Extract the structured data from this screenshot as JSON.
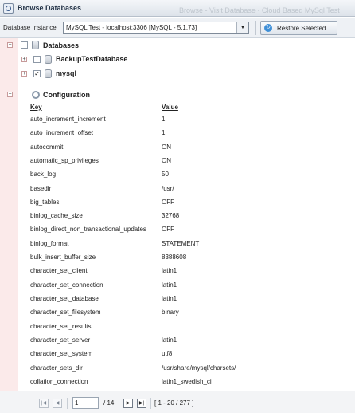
{
  "window": {
    "title": "Browse Databases",
    "ghost_text": "Browse  - Visit  Database  ·  Cloud Based MySql Test"
  },
  "toolbar": {
    "instance_label": "Database Instance",
    "instance_value": "MySQL Test - localhost:3306 [MySQL - 5.1.73]",
    "restore_label": "Restore Selected"
  },
  "tree": {
    "root_label": "Databases",
    "databases": [
      {
        "label": "BackupTestDatabase",
        "checked": false
      },
      {
        "label": "mysql",
        "checked": true
      }
    ],
    "config_label": "Configuration"
  },
  "config_table": {
    "headers": {
      "key": "Key",
      "value": "Value"
    },
    "rows": [
      {
        "key": "auto_increment_increment",
        "value": "1"
      },
      {
        "key": "auto_increment_offset",
        "value": "1"
      },
      {
        "key": "autocommit",
        "value": "ON"
      },
      {
        "key": "automatic_sp_privileges",
        "value": "ON"
      },
      {
        "key": "back_log",
        "value": "50"
      },
      {
        "key": "basedir",
        "value": "/usr/"
      },
      {
        "key": "big_tables",
        "value": "OFF"
      },
      {
        "key": "binlog_cache_size",
        "value": "32768"
      },
      {
        "key": "binlog_direct_non_transactional_updates",
        "value": "OFF"
      },
      {
        "key": "binlog_format",
        "value": "STATEMENT"
      },
      {
        "key": "bulk_insert_buffer_size",
        "value": "8388608"
      },
      {
        "key": "character_set_client",
        "value": "latin1"
      },
      {
        "key": "character_set_connection",
        "value": "latin1"
      },
      {
        "key": "character_set_database",
        "value": "latin1"
      },
      {
        "key": "character_set_filesystem",
        "value": "binary"
      },
      {
        "key": "character_set_results",
        "value": ""
      },
      {
        "key": "character_set_server",
        "value": "latin1"
      },
      {
        "key": "character_set_system",
        "value": "utf8"
      },
      {
        "key": "character_sets_dir",
        "value": "/usr/share/mysql/charsets/"
      },
      {
        "key": "collation_connection",
        "value": "latin1_swedish_ci"
      }
    ]
  },
  "pager": {
    "page": "1",
    "of_label": "/ 14",
    "range": "[ 1 - 20 / 277 ]"
  },
  "colors": {
    "gutter": "#fbeaea",
    "accent": "#3e8fd7"
  }
}
